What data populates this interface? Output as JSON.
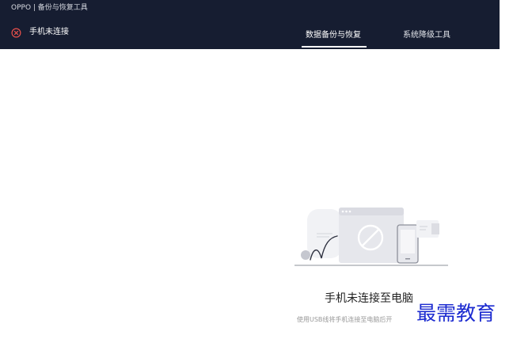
{
  "window": {
    "title": "OPPO | 备份与恢复工具"
  },
  "status": {
    "icon": "close-circle-icon",
    "text": "手机未连接",
    "color": "#e8504b"
  },
  "tabs": [
    {
      "label": "数据备份与恢复",
      "active": true
    },
    {
      "label": "系统降级工具",
      "active": false
    }
  ],
  "empty_state": {
    "illustration": "phone-disconnected-illustration",
    "title": "手机未连接至电脑",
    "description": "使用USB线将手机连接至电脑后开"
  },
  "watermark": {
    "text": "最需教育"
  },
  "colors": {
    "titlebar": "#161d31",
    "accent": "#ffffff",
    "watermark": "#1c2bd0"
  }
}
